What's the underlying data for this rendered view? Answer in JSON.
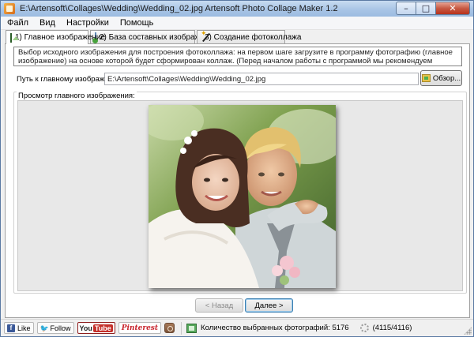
{
  "window": {
    "title": "E:\\Artensoft\\Collages\\Wedding\\Wedding_02.jpg Artensoft Photo Collage Maker 1.2",
    "controls": {
      "minimize": "–",
      "maximize": "□",
      "close": "✕"
    }
  },
  "menu": {
    "items": [
      {
        "label": "Файл"
      },
      {
        "label": "Вид"
      },
      {
        "label": "Настройки"
      },
      {
        "label": "Помощь"
      }
    ]
  },
  "tabs": [
    {
      "label": "1) Главное изображение",
      "icon": "image-icon",
      "active": true
    },
    {
      "label": "2) База составных изображений",
      "icon": "database-icon",
      "active": false
    },
    {
      "label": "3) Создание фотоколлажа",
      "icon": "magic-wand-icon",
      "active": false
    }
  ],
  "main": {
    "info_text": "Выбор исходного изображения для построения фотоколлажа: на первом шаге загрузите в программу фотографию (главное изображение) на основе которой будет сформирован коллаж. (Перед началом работы с программой мы рекомендуем проверить основные настройки: Главное меню->Настройки)",
    "path_label": "Путь к главному изображению:",
    "path_value": "E:\\Artensoft\\Collages\\Wedding\\Wedding_02.jpg",
    "browse_label": "Обзор...",
    "preview_label": "Просмотр главного изображения:",
    "prev_label": "< Назад",
    "next_label": "Далее >"
  },
  "status": {
    "like_label": "Like",
    "follow_label": "Follow",
    "youtube_you": "You",
    "youtube_tube": "Tube",
    "pinterest_label": "Pinterest",
    "count_text": "Количество выбранных фотографий: 5176",
    "progress_text": "(4115/4116)"
  },
  "colors": {
    "titlebar": "#a9c5e6",
    "close_button": "#c75a44",
    "facebook": "#3b5998",
    "youtube": "#c4302b",
    "pinterest": "#c8232c"
  }
}
